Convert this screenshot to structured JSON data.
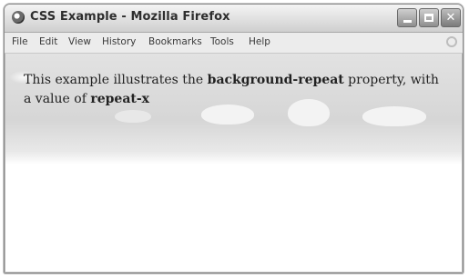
{
  "window": {
    "title": "CSS Example - Mozilla Firefox"
  },
  "menubar": {
    "items": [
      "File",
      "Edit",
      "View",
      "History",
      "Bookmarks",
      "Tools",
      "Help"
    ]
  },
  "content": {
    "text_before": "This example illustrates the ",
    "property_name": "background-repeat",
    "text_middle": " property, with a value of ",
    "property_value": "repeat-x"
  },
  "colors": {
    "titlebar_gradient_top": "#f4f4f4",
    "titlebar_gradient_bottom": "#cfcfcf",
    "background_band": "#d6d6d6",
    "page_background": "#ffffff"
  }
}
